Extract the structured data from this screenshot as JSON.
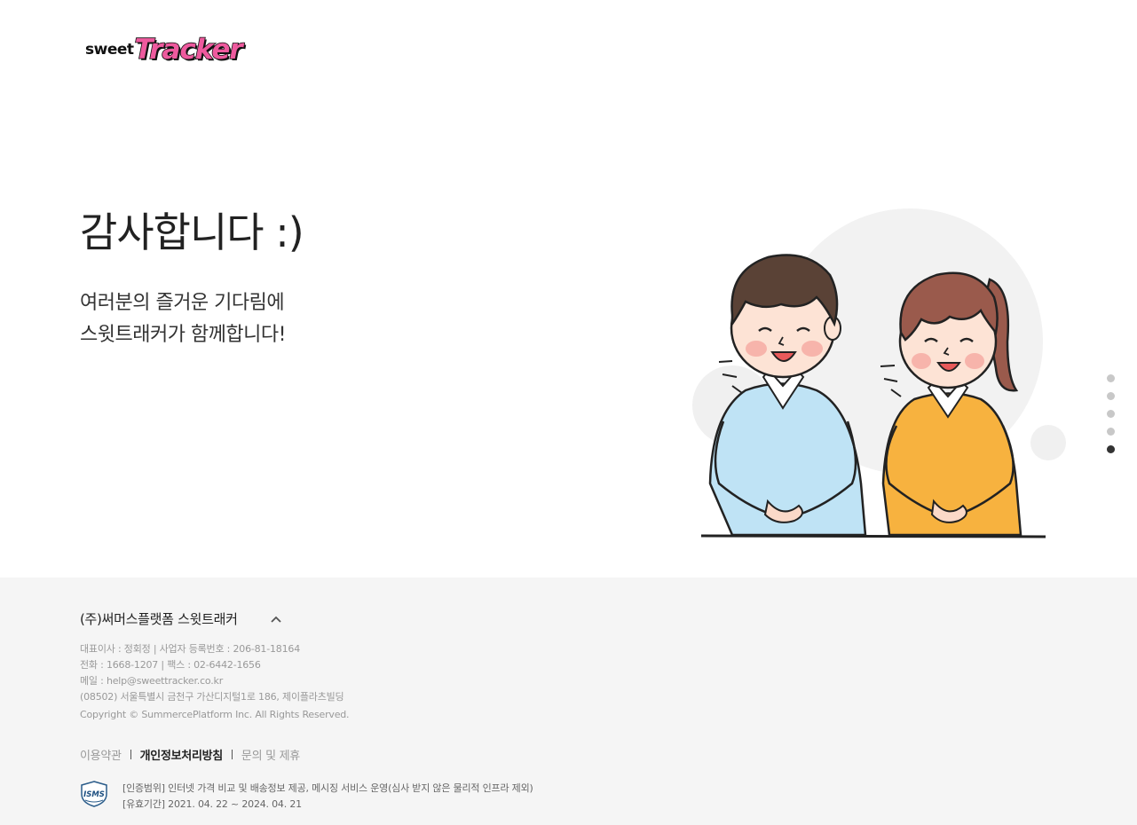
{
  "logo": {
    "text_sweet": "sweet",
    "text_tracker": "Tracker"
  },
  "hero": {
    "title": "감사합니다 :)",
    "subtitle_line1": "여러분의 즐거운 기다림에",
    "subtitle_line2": "스윗트래커가 함께합니다!"
  },
  "illustration": {
    "icon": "thank-you-couple-illustration"
  },
  "pagination": {
    "total": 5,
    "active_index": 4
  },
  "footer": {
    "company_name": "(주)써머스플랫폼 스윗트래커",
    "toggle_icon": "chevron-up-icon",
    "info_ceo_biz": "대표이사 : 정회정 | 사업자 등록번호 : 206-81-18164",
    "info_phone_fax": "전화 : 1668-1207 | 팩스 : 02-6442-1656",
    "info_email": "메일 : help@sweettracker.co.kr",
    "info_address": "(08502) 서울특별시 금천구 가산디지털1로 186, 제이플라츠빌딩",
    "copyright": "Copyright © SummercePlatform Inc. All Rights Reserved.",
    "links": {
      "terms": "이용약관",
      "privacy": "개인정보처리방침",
      "contact": "문의 및 제휴"
    },
    "isms": {
      "logo_text": "ISMS",
      "scope": "[인증범위] 인터넷 가격 비교 및 배송정보 제공, 메시징 서비스 운영(심사 받지 않은 물리적 인프라 제외)",
      "validity": "[유효기간] 2021. 04. 22 ~ 2024. 04. 21"
    }
  },
  "colors": {
    "brand_pink": "#ee5a9e",
    "footer_bg": "#f5f5f5",
    "dot_inactive": "#c8c8c8",
    "dot_active": "#333333"
  }
}
